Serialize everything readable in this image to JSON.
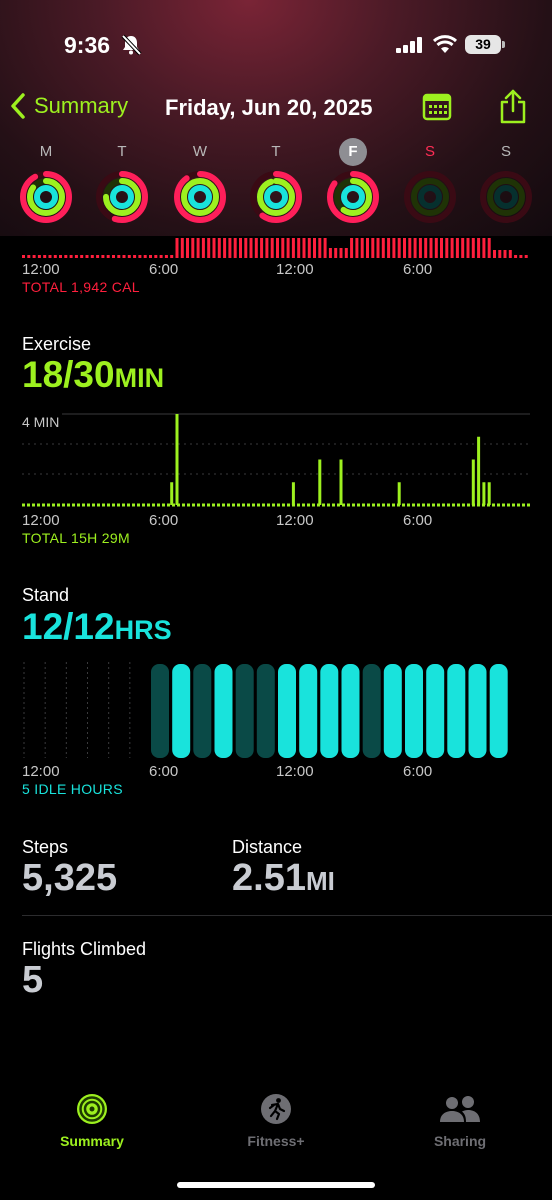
{
  "status": {
    "time": "9:36",
    "battery": "39"
  },
  "nav": {
    "back_label": "Summary",
    "title": "Friday, Jun 20, 2025"
  },
  "week": {
    "days": [
      {
        "letter": "M",
        "move": 0.92,
        "exercise": 0.85,
        "stand": 1.0
      },
      {
        "letter": "T",
        "move": 0.55,
        "exercise": 0.75,
        "stand": 1.0
      },
      {
        "letter": "W",
        "move": 0.9,
        "exercise": 1.0,
        "stand": 1.0
      },
      {
        "letter": "T",
        "move": 0.6,
        "exercise": 0.95,
        "stand": 1.0
      },
      {
        "letter": "F",
        "move": 0.85,
        "exercise": 0.6,
        "stand": 1.0
      },
      {
        "letter": "S",
        "move": 0.0,
        "exercise": 0.0,
        "stand": 0.0
      },
      {
        "letter": "S",
        "move": 0.0,
        "exercise": 0.0,
        "stand": 0.0
      }
    ]
  },
  "move": {
    "total": "TOTAL 1,942 CAL",
    "color": "#ff1f3d"
  },
  "axis": [
    "12:00",
    "6:00",
    "12:00",
    "6:00"
  ],
  "exercise": {
    "label": "Exercise",
    "value": "18/30",
    "unit": "MIN",
    "scale_label": "4 MIN",
    "total": "TOTAL 15H 29M",
    "color": "#9df01f"
  },
  "stand": {
    "label": "Stand",
    "value": "12/12",
    "unit": "HRS",
    "total": "5 IDLE HOURS",
    "color": "#19e3dc"
  },
  "stats": {
    "steps_label": "Steps",
    "steps_value": "5,325",
    "distance_label": "Distance",
    "distance_value": "2.51",
    "distance_unit": "MI",
    "flights_label": "Flights Climbed",
    "flights_value": "5"
  },
  "tabs": [
    {
      "label": "Summary",
      "icon": "activity-rings-icon",
      "active": true
    },
    {
      "label": "Fitness+",
      "icon": "runner-icon",
      "active": false
    },
    {
      "label": "Sharing",
      "icon": "people-icon",
      "active": false
    }
  ],
  "chart_data": [
    {
      "type": "bar",
      "title": "Exercise",
      "x_ticks": [
        "12:00",
        "6:00",
        "12:00",
        "6:00"
      ],
      "x": [
        "07:00",
        "07:15",
        "12:45",
        "14:00",
        "15:00",
        "17:45",
        "21:15",
        "21:30",
        "21:45",
        "22:00"
      ],
      "values": [
        1,
        4,
        1,
        2,
        2,
        1,
        2,
        3,
        1,
        1
      ],
      "y_tick": "4 MIN",
      "ylim": [
        0,
        4
      ]
    },
    {
      "type": "bar",
      "title": "Stand",
      "x_ticks": [
        "12:00",
        "6:00",
        "12:00",
        "6:00"
      ],
      "x": [
        "06:00",
        "07:00",
        "08:00",
        "09:00",
        "10:00",
        "11:00",
        "12:00",
        "13:00",
        "14:00",
        "15:00",
        "16:00",
        "17:00",
        "18:00",
        "19:00",
        "20:00",
        "21:00",
        "22:00"
      ],
      "values": [
        0,
        1,
        0,
        1,
        0,
        0,
        1,
        1,
        1,
        1,
        0,
        1,
        1,
        1,
        1,
        1,
        1
      ]
    }
  ]
}
